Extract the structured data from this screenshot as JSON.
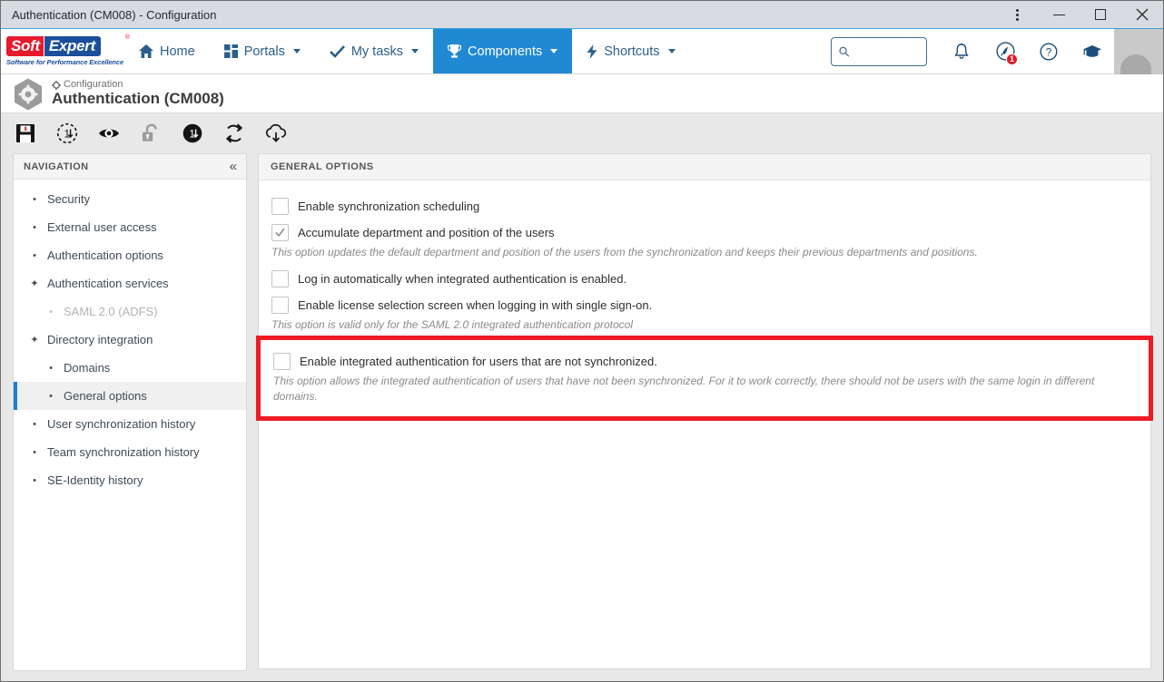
{
  "window": {
    "title": "Authentication (CM008) - Configuration",
    "controls": {
      "menu": "⋮",
      "minimize": "—",
      "maximize": "□",
      "close": "✕"
    }
  },
  "brand": {
    "soft": "Soft",
    "expert": "Expert",
    "registered": "®",
    "tagline": "Software for Performance Excellence",
    "colors": {
      "red": "#e8192c",
      "blue": "#1b4f9c"
    }
  },
  "nav": {
    "items": [
      {
        "label": "Home",
        "icon": "home-icon",
        "caret": false,
        "active": false
      },
      {
        "label": "Portals",
        "icon": "grid-icon",
        "caret": true,
        "active": false
      },
      {
        "label": "My tasks",
        "icon": "check-icon",
        "caret": true,
        "active": false
      },
      {
        "label": "Components",
        "icon": "trophy-icon",
        "caret": true,
        "active": true
      },
      {
        "label": "Shortcuts",
        "icon": "lightning-icon",
        "caret": true,
        "active": false
      }
    ],
    "active_color": "#2089d4"
  },
  "header_right": {
    "search": {
      "value": "",
      "placeholder": "",
      "icon": "search-icon"
    },
    "icons": [
      {
        "name": "bell-icon",
        "badge": null
      },
      {
        "name": "activity-circle-icon",
        "badge": "1"
      },
      {
        "name": "help-icon",
        "badge": null
      },
      {
        "name": "academy-cap-icon",
        "badge": null
      }
    ],
    "badge_color": "#e01b28",
    "avatar": "user-avatar"
  },
  "page": {
    "icon": "configuration-hex-gear-icon",
    "breadcrumb_icon": "gear-icon",
    "breadcrumb": "Configuration",
    "title": "Authentication (CM008)"
  },
  "toolbar": {
    "buttons": [
      {
        "name": "save-icon",
        "label": "Save"
      },
      {
        "name": "revision-dashed-icon",
        "label": "Revision"
      },
      {
        "name": "view-eye-icon",
        "label": "View"
      },
      {
        "name": "unlock-icon",
        "label": "Unlock"
      },
      {
        "name": "version-filled-icon",
        "label": "Version"
      },
      {
        "name": "sync-refresh-icon",
        "label": "Synchronize"
      },
      {
        "name": "cloud-download-icon",
        "label": "Import"
      }
    ]
  },
  "navigation": {
    "header": "NAVIGATION",
    "collapse_icon": "«",
    "items": [
      {
        "label": "Security",
        "level": 1,
        "marker": "bullet",
        "selected": false,
        "muted": false
      },
      {
        "label": "External user access",
        "level": 1,
        "marker": "bullet",
        "selected": false,
        "muted": false
      },
      {
        "label": "Authentication options",
        "level": 1,
        "marker": "bullet",
        "selected": false,
        "muted": false
      },
      {
        "label": "Authentication services",
        "level": 1,
        "marker": "expanded",
        "selected": false,
        "muted": false
      },
      {
        "label": "SAML 2.0 (ADFS)",
        "level": 2,
        "marker": "bullet",
        "selected": false,
        "muted": true
      },
      {
        "label": "Directory integration",
        "level": 1,
        "marker": "expanded",
        "selected": false,
        "muted": false
      },
      {
        "label": "Domains",
        "level": 2,
        "marker": "bullet",
        "selected": false,
        "muted": false
      },
      {
        "label": "General options",
        "level": 2,
        "marker": "bullet",
        "selected": true,
        "muted": false
      },
      {
        "label": "User synchronization history",
        "level": 1,
        "marker": "bullet",
        "selected": false,
        "muted": false
      },
      {
        "label": "Team synchronization history",
        "level": 1,
        "marker": "bullet",
        "selected": false,
        "muted": false
      },
      {
        "label": "SE-Identity history",
        "level": 1,
        "marker": "bullet",
        "selected": false,
        "muted": false
      }
    ],
    "selected_accent": "#1b7fd4"
  },
  "main": {
    "header": "GENERAL OPTIONS",
    "options": [
      {
        "label": "Enable synchronization scheduling",
        "checked": false,
        "hint": null
      },
      {
        "label": "Accumulate department and position of the users",
        "checked": true,
        "hint": "This option updates the default department and position of the users from the synchronization and keeps their previous departments and positions."
      },
      {
        "label": "Log in automatically when integrated authentication is enabled.",
        "checked": false,
        "hint": null
      },
      {
        "label": "Enable license selection screen when logging in with single sign-on.",
        "checked": false,
        "hint": "This option is valid only for the SAML 2.0 integrated authentication protocol"
      }
    ],
    "highlighted_option": {
      "label": "Enable integrated authentication for users that are not synchronized.",
      "checked": false,
      "hint": "This option allows the integrated authentication of users that have not been synchronized. For it to work correctly, there should not be users with the same login in different domains.",
      "highlight_color": "#ee1b24"
    }
  }
}
